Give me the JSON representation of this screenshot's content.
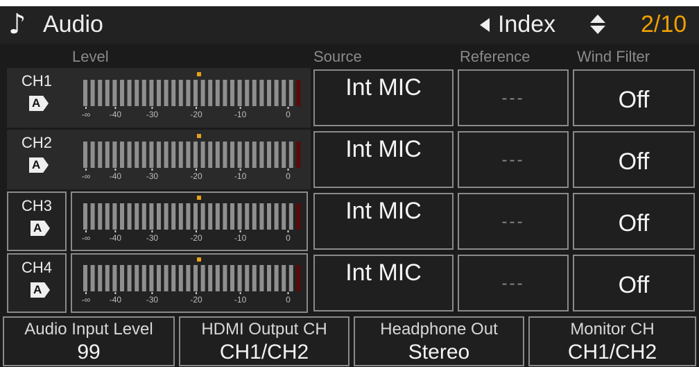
{
  "header": {
    "icon": "music-note-icon",
    "title": "Audio",
    "nav_label": "Index",
    "page_indicator": "2/10",
    "page_color": "#f0a000"
  },
  "columns": {
    "level": "Level",
    "source": "Source",
    "reference": "Reference",
    "wind_filter": "Wind Filter"
  },
  "meter_scale": [
    "-∞",
    "-40",
    "-30",
    "-20",
    "-10",
    "0"
  ],
  "channels": [
    {
      "label": "CH1",
      "mode_badge": "A",
      "source": "Int MIC",
      "reference": "---",
      "wind_filter": "Off",
      "boxed": false
    },
    {
      "label": "CH2",
      "mode_badge": "A",
      "source": "Int MIC",
      "reference": "---",
      "wind_filter": "Off",
      "boxed": false
    },
    {
      "label": "CH3",
      "mode_badge": "A",
      "source": "Int MIC",
      "reference": "---",
      "wind_filter": "Off",
      "boxed": true
    },
    {
      "label": "CH4",
      "mode_badge": "A",
      "source": "Int MIC",
      "reference": "---",
      "wind_filter": "Off",
      "boxed": true
    }
  ],
  "bottom": [
    {
      "label": "Audio Input Level",
      "value": "99"
    },
    {
      "label": "HDMI Output CH",
      "value": "CH1/CH2"
    },
    {
      "label": "Headphone Out",
      "value": "Stereo"
    },
    {
      "label": "Monitor CH",
      "value": "CH1/CH2"
    }
  ],
  "colors": {
    "meter_segment": "#8f8f8f",
    "meter_peak": "#e6a21a",
    "meter_overload": "#5a0a0a"
  }
}
